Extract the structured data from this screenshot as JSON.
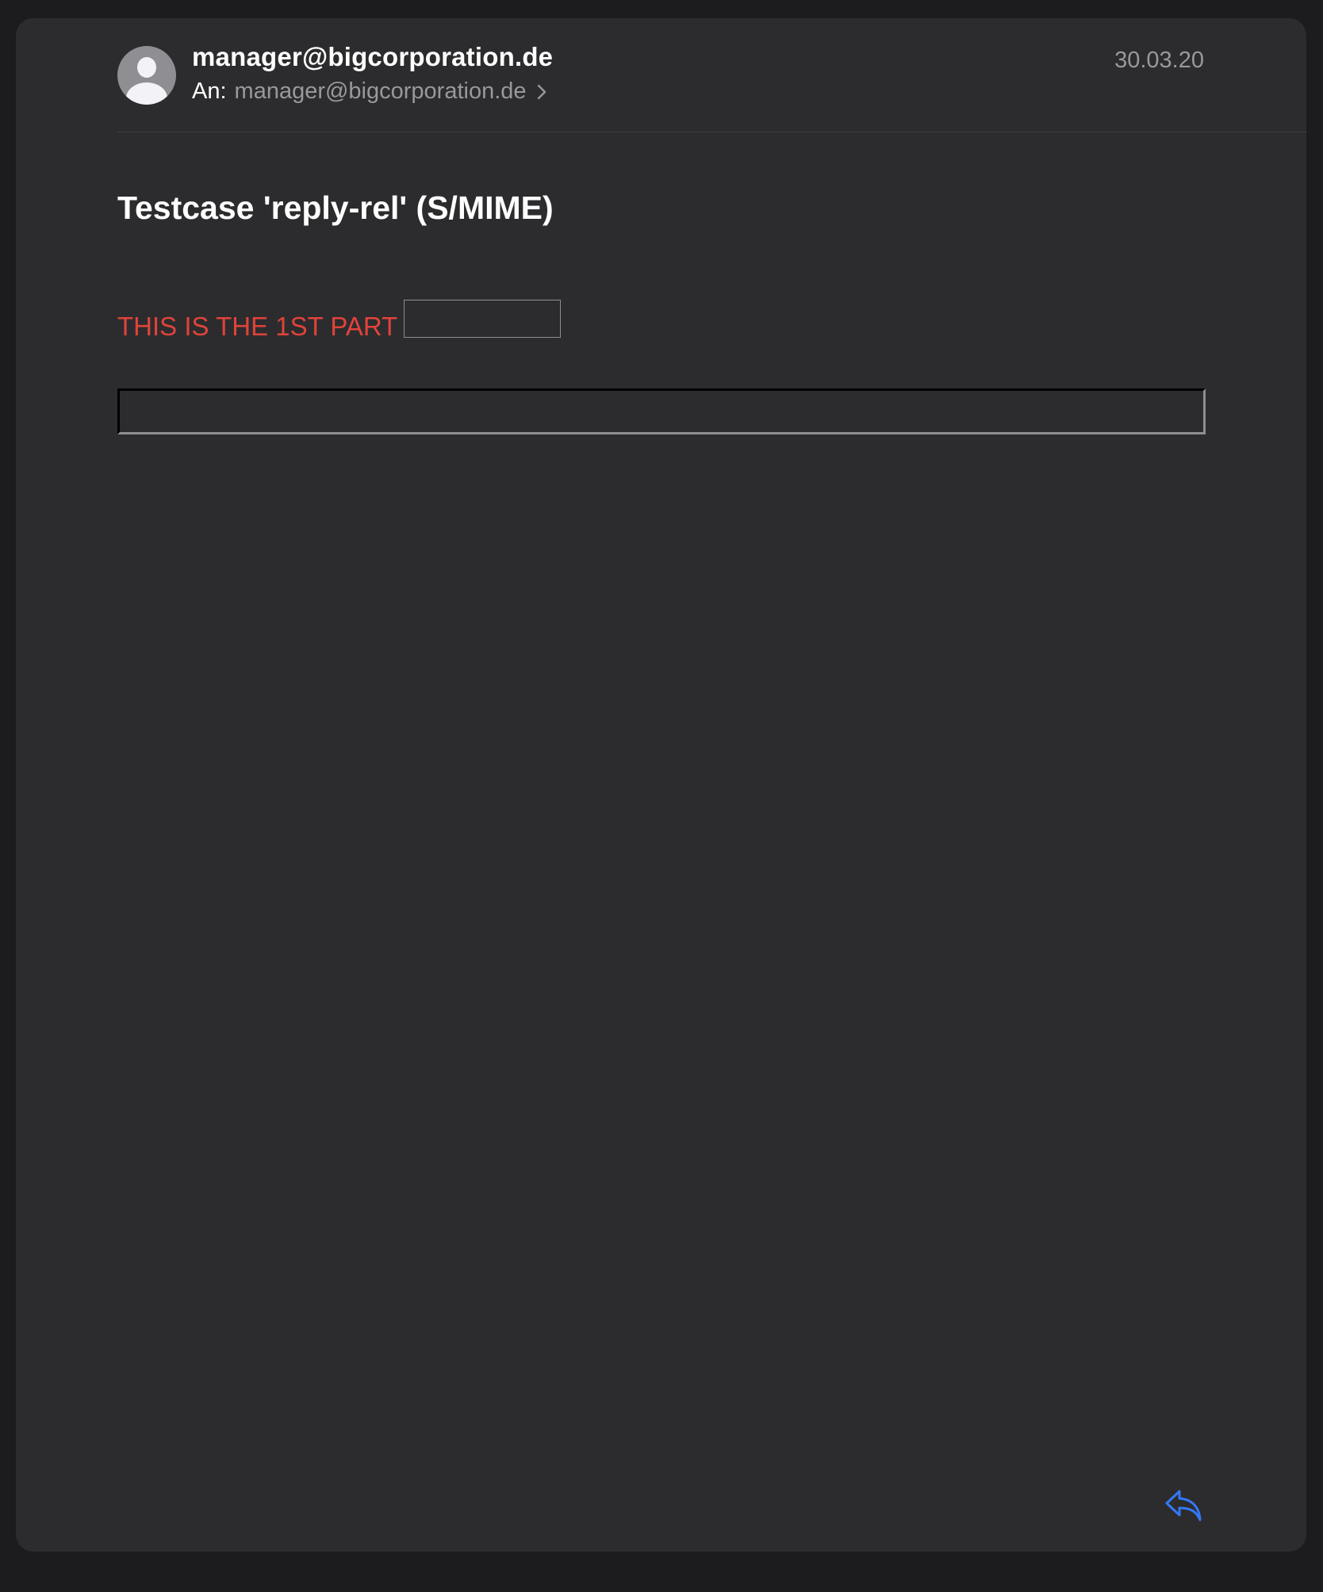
{
  "header": {
    "sender": "manager@bigcorporation.de",
    "to_label": "An:",
    "to_address": "manager@bigcorporation.de",
    "date": "30.03.20"
  },
  "message": {
    "subject": "Testcase 'reply-rel' (S/MIME)",
    "part_text": "THIS IS THE 1ST PART",
    "part_text_color": "#e0433a"
  },
  "icons": {
    "avatar": "person-avatar-icon",
    "chevron": "chevron-right-icon",
    "reply": "reply-arrow-icon"
  },
  "colors": {
    "background": "#1c1c1e",
    "card": "#2c2c2e",
    "accent": "#3478f6",
    "secondary_text": "#98989d"
  }
}
